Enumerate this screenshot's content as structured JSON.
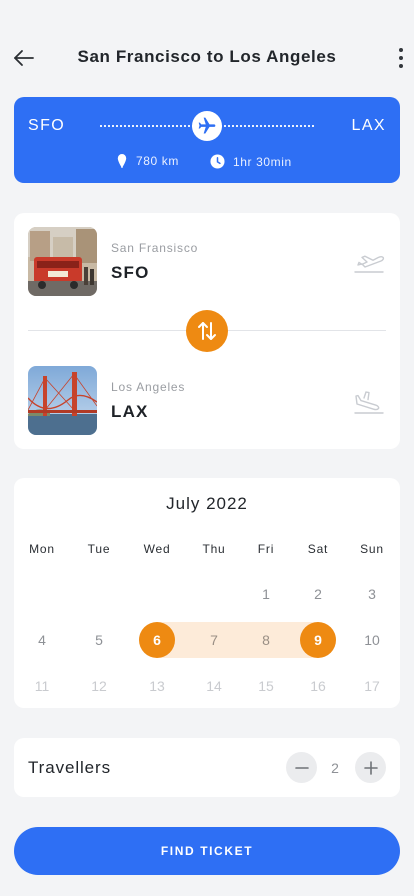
{
  "header": {
    "title": "San Francisco to Los Angeles",
    "back_icon": "arrow-left-icon",
    "menu_icon": "more-vertical-icon"
  },
  "route": {
    "from_code": "SFO",
    "to_code": "LAX",
    "distance": "780 km",
    "duration": "1hr 30min",
    "accent_color": "#2e6ff4"
  },
  "airports": {
    "from": {
      "city": "San Fransisco",
      "code": "SFO",
      "icon": "plane-takeoff-icon"
    },
    "to": {
      "city": "Los Angeles",
      "code": "LAX",
      "icon": "plane-landing-icon"
    },
    "swap_icon": "swap-vertical-icon",
    "swap_color": "#ee8a12"
  },
  "calendar": {
    "month_label": "July 2022",
    "weekdays": [
      "Mon",
      "Tue",
      "Wed",
      "Thu",
      "Fri",
      "Sat",
      "Sun"
    ],
    "weeks": [
      [
        null,
        null,
        null,
        null,
        1,
        2,
        3
      ],
      [
        4,
        5,
        6,
        7,
        8,
        9,
        10
      ],
      [
        11,
        12,
        13,
        14,
        15,
        16,
        17
      ]
    ],
    "range_start": 6,
    "range_end": 9,
    "muted_from": 11
  },
  "travellers": {
    "label": "Travellers",
    "count": "2",
    "minus_icon": "minus-icon",
    "plus_icon": "plus-icon"
  },
  "cta": {
    "label": "FIND TICKET"
  }
}
